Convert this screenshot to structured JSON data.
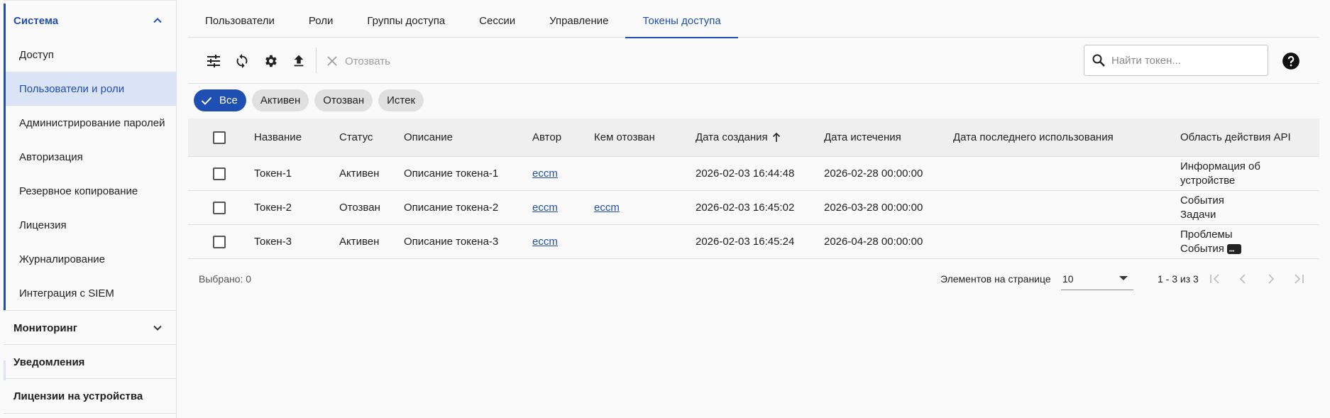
{
  "sidebar": {
    "section_system": "Система",
    "items": [
      {
        "label": "Доступ"
      },
      {
        "label": "Пользователи и роли"
      },
      {
        "label": "Администрирование паролей"
      },
      {
        "label": "Авторизация"
      },
      {
        "label": "Резервное копирование"
      },
      {
        "label": "Лицензия"
      },
      {
        "label": "Журналирование"
      },
      {
        "label": "Интеграция с SIEM"
      }
    ],
    "section_monitoring": "Мониторинг",
    "section_notifications": "Уведомления",
    "section_device_licenses": "Лицензии на устройства"
  },
  "tabs": [
    {
      "label": "Пользователи"
    },
    {
      "label": "Роли"
    },
    {
      "label": "Группы доступа"
    },
    {
      "label": "Сессии"
    },
    {
      "label": "Управление"
    },
    {
      "label": "Токены доступа"
    }
  ],
  "toolbar": {
    "revoke_label": "Отозвать",
    "search_placeholder": "Найти токен..."
  },
  "filters": [
    {
      "label": "Все",
      "active": true
    },
    {
      "label": "Активен"
    },
    {
      "label": "Отозван"
    },
    {
      "label": "Истек"
    }
  ],
  "table": {
    "headers": {
      "name": "Название",
      "status": "Статус",
      "description": "Описание",
      "author": "Автор",
      "revoked_by": "Кем отозван",
      "created": "Дата создания",
      "expires": "Дата истечения",
      "last_used": "Дата последнего использования",
      "scope": "Область действия API"
    },
    "rows": [
      {
        "name": "Токен-1",
        "status": "Активен",
        "description": "Описание токена-1",
        "author": "eccm",
        "revoked_by": "",
        "created": "2026-02-03 16:44:48",
        "expires": "2026-02-28 00:00:00",
        "last_used": "",
        "scope_line1": "Информация об",
        "scope_line2": "устройстве"
      },
      {
        "name": "Токен-2",
        "status": "Отозван",
        "description": "Описание токена-2",
        "author": "eccm",
        "revoked_by": "eccm",
        "created": "2026-02-03 16:45:02",
        "expires": "2026-03-28 00:00:00",
        "last_used": "",
        "scope_line1": "События",
        "scope_line2": "Задачи"
      },
      {
        "name": "Токен-3",
        "status": "Активен",
        "description": "Описание токена-3",
        "author": "eccm",
        "revoked_by": "",
        "created": "2026-02-03 16:45:24",
        "expires": "2026-04-28 00:00:00",
        "last_used": "",
        "scope_line1": "Проблемы",
        "scope_line2": "События"
      }
    ]
  },
  "footer": {
    "selected": "Выбрано: 0",
    "per_page_label": "Элементов на странице",
    "per_page_value": "10",
    "range": "1 - 3 из 3"
  },
  "colors": {
    "accent": "#1f4fb3",
    "selected_bg": "#dbe3f7",
    "chip_bg": "#e0e0e0"
  }
}
